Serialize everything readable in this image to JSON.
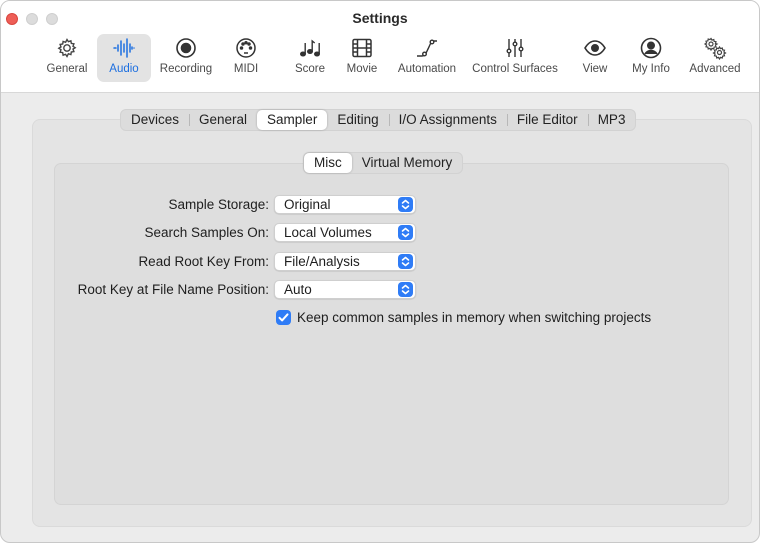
{
  "window": {
    "title": "Settings"
  },
  "toolbar": {
    "items": [
      {
        "label": "General",
        "icon": "gear-icon"
      },
      {
        "label": "Audio",
        "icon": "waveform-icon",
        "selected": true
      },
      {
        "label": "Recording",
        "icon": "record-icon"
      },
      {
        "label": "MIDI",
        "icon": "midi-port-icon"
      },
      {
        "label": "Score",
        "icon": "music-notes-icon"
      },
      {
        "label": "Movie",
        "icon": "film-icon"
      },
      {
        "label": "Automation",
        "icon": "automation-curve-icon"
      },
      {
        "label": "Control Surfaces",
        "icon": "faders-icon"
      },
      {
        "label": "View",
        "icon": "eye-icon"
      },
      {
        "label": "My Info",
        "icon": "person-icon"
      },
      {
        "label": "Advanced",
        "icon": "gears-icon"
      }
    ]
  },
  "tabs": [
    "Devices",
    "General",
    "Sampler",
    "Editing",
    "I/O Assignments",
    "File Editor",
    "MP3"
  ],
  "active_tab": "Sampler",
  "subtabs": [
    "Misc",
    "Virtual Memory"
  ],
  "active_subtab": "Misc",
  "settings": [
    {
      "label": "Sample Storage:",
      "value": "Original"
    },
    {
      "label": "Search Samples On:",
      "value": "Local Volumes"
    },
    {
      "label": "Read Root Key From:",
      "value": "File/Analysis"
    },
    {
      "label": "Root Key at File Name Position:",
      "value": "Auto"
    }
  ],
  "keep_in_memory": {
    "label": "Keep common samples in memory when switching projects",
    "checked": true
  },
  "colors": {
    "accent": "#2f7cf6",
    "selected_label": "#1d6fe0",
    "close": "#ee5e57"
  }
}
